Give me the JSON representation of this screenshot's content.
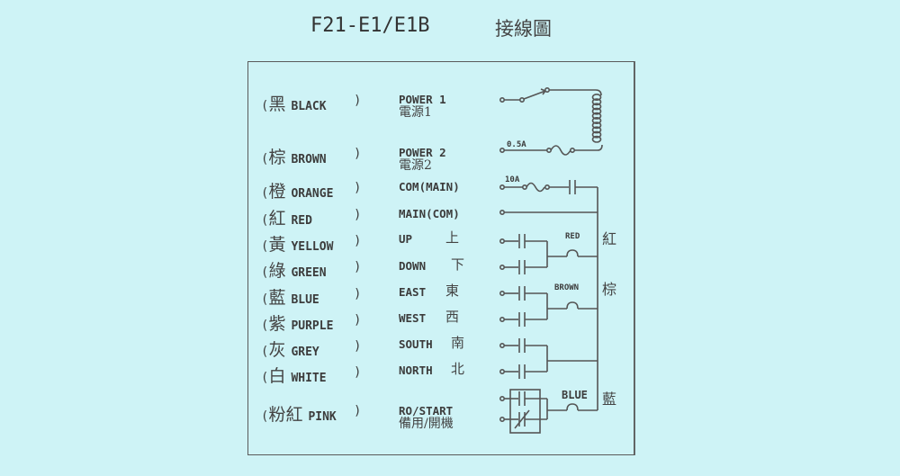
{
  "header": {
    "model": "F21-E1/E1B",
    "title_cn": "接線圖"
  },
  "wires": [
    {
      "cn": "黑",
      "color": "BLACK",
      "function": "POWER 1",
      "function_cn": "電源1"
    },
    {
      "cn": "棕",
      "color": "BROWN",
      "function": "POWER 2",
      "function_cn": "電源2"
    },
    {
      "cn": "橙",
      "color": "ORANGE",
      "function": "COM(MAIN)",
      "function_cn": ""
    },
    {
      "cn": "紅",
      "color": "RED",
      "function": "MAIN(COM)",
      "function_cn": ""
    },
    {
      "cn": "黃",
      "color": "YELLOW",
      "function": "UP",
      "function_cn": "上"
    },
    {
      "cn": "綠",
      "color": "GREEN",
      "function": "DOWN",
      "function_cn": "下"
    },
    {
      "cn": "藍",
      "color": "BLUE",
      "function": "EAST",
      "function_cn": "東"
    },
    {
      "cn": "紫",
      "color": "PURPLE",
      "function": "WEST",
      "function_cn": "西"
    },
    {
      "cn": "灰",
      "color": "GREY",
      "function": "SOUTH",
      "function_cn": "南"
    },
    {
      "cn": "白",
      "color": "WHITE",
      "function": "NORTH",
      "function_cn": "北"
    },
    {
      "cn": "粉紅",
      "color": "PINK",
      "function": "RO/START",
      "function_cn": "備用/開機"
    }
  ],
  "schematic": {
    "fuse_power": "0.5A",
    "fuse_main": "10A",
    "common_labels": [
      {
        "en": "RED",
        "cn": "紅"
      },
      {
        "en": "BROWN",
        "cn": "棕"
      },
      {
        "en": "BLUE",
        "cn": "藍"
      }
    ]
  },
  "paren_open": "(",
  "paren_close": ")"
}
